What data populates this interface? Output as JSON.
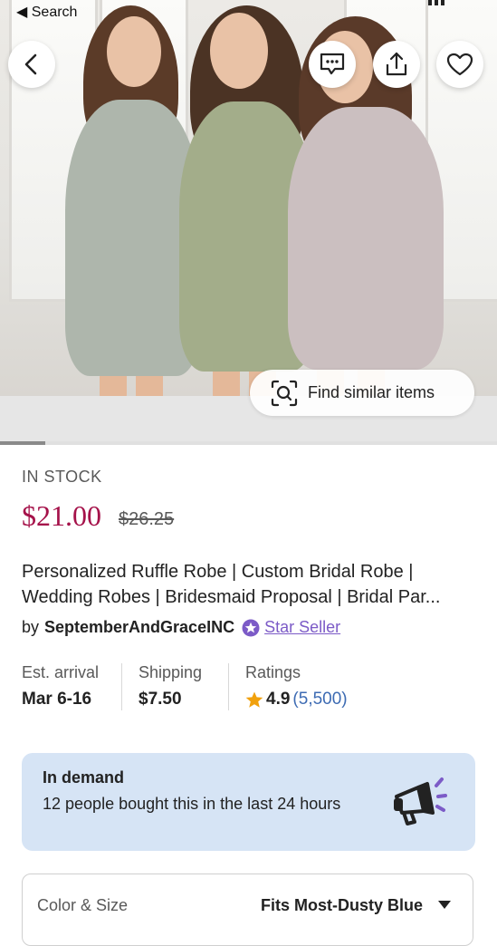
{
  "status_bar": {
    "back_label": "◀ Search"
  },
  "hero": {
    "icons": [
      "back-arrow-icon",
      "message-icon",
      "share-icon",
      "heart-icon",
      "visual-search-icon"
    ],
    "find_similar_label": "Find similar items"
  },
  "product": {
    "stock_label": "IN STOCK",
    "price": "$21.00",
    "original_price": "$26.25",
    "title_line1": "Personalized Ruffle Robe | Custom Bridal Robe |",
    "title_line2": "Wedding Robes | Bridesmaid Proposal | Bridal Par...",
    "by_label": "by",
    "seller_name": "SeptemberAndGraceINC",
    "seller_badge": "Star Seller"
  },
  "details": {
    "arrival_label": "Est. arrival",
    "arrival_value": "Mar 6-16",
    "shipping_label": "Shipping",
    "shipping_value": "$7.50",
    "ratings_label": "Ratings",
    "rating_value": "4.9",
    "rating_count": "(5,500)"
  },
  "demand": {
    "heading": "In demand",
    "body": "12 people bought this in the last 24 hours"
  },
  "variation": {
    "label": "Color & Size",
    "value": "Fits Most-Dusty Blue"
  },
  "colors": {
    "price": "#a5124a",
    "star_seller": "#7c5bc7",
    "rating_count": "#3d6bb3",
    "demand_bg": "#d6e4f5",
    "star": "#f1a10d"
  }
}
